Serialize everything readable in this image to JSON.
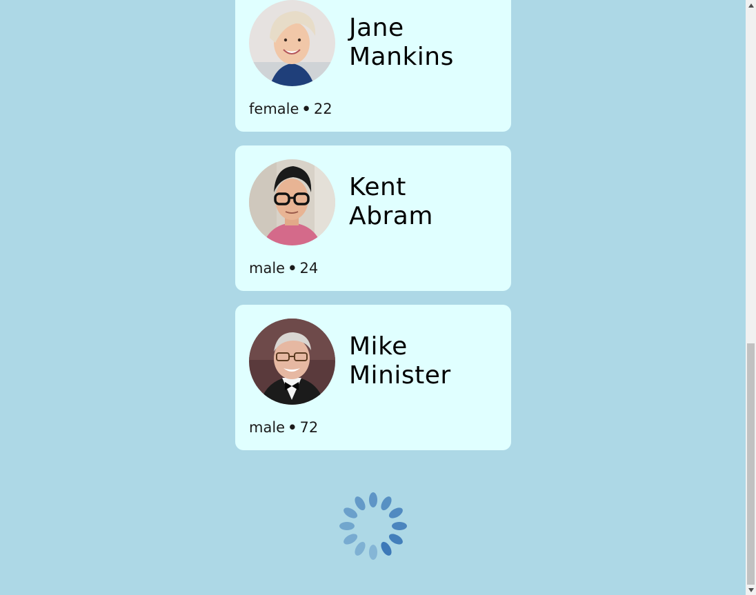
{
  "people": [
    {
      "first_name": "Jane",
      "last_name": "Mankins",
      "gender": "female",
      "age": "22",
      "dot": "•"
    },
    {
      "first_name": "Kent",
      "last_name": "Abram",
      "gender": "male",
      "age": "24",
      "dot": "•"
    },
    {
      "first_name": "Mike",
      "last_name": "Minister",
      "gender": "male",
      "age": "72",
      "dot": "•"
    }
  ],
  "spinner": {
    "icon": "loading-spinner-icon",
    "color": "#3d79b8"
  },
  "colors": {
    "background": "#add8e6",
    "card": "#e0ffff"
  }
}
